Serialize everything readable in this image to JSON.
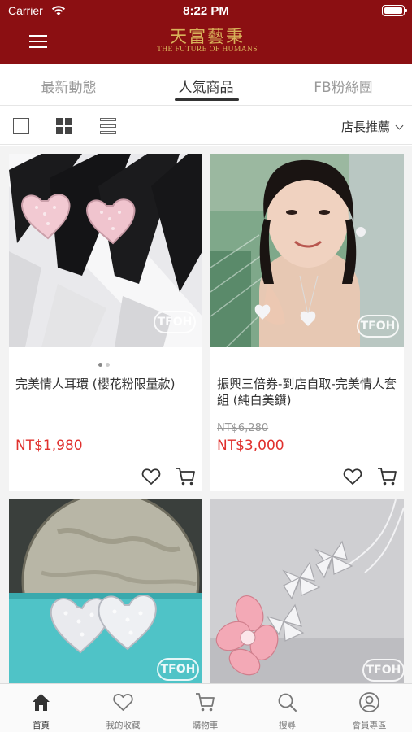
{
  "status_bar": {
    "carrier": "Carrier",
    "time": "8:22 PM"
  },
  "header": {
    "logo_main": "天富藝秉",
    "logo_sub": "THE FUTURE OF HUMANS",
    "color": "#8b0f12"
  },
  "tabs": [
    {
      "label": "最新動態",
      "active": false
    },
    {
      "label": "人氣商品",
      "active": true
    },
    {
      "label": "FB粉絲團",
      "active": false
    }
  ],
  "toolbar": {
    "sort_label": "店長推薦"
  },
  "watermark": "TFOH",
  "products": [
    {
      "name": "完美情人耳環 (櫻花粉限量款)",
      "original_price": "",
      "price": "NT$1,980"
    },
    {
      "name": "振興三倍券-到店自取-完美情人套組 (純白美鑽)",
      "original_price": "NT$6,280",
      "price": "NT$3,000"
    },
    {
      "name": "",
      "original_price": "",
      "price": ""
    },
    {
      "name": "",
      "original_price": "",
      "price": ""
    }
  ],
  "tabbar": [
    {
      "label": "首頁",
      "icon": "home-icon",
      "active": true
    },
    {
      "label": "我的收藏",
      "icon": "heart-icon",
      "active": false
    },
    {
      "label": "購物車",
      "icon": "cart-icon",
      "active": false
    },
    {
      "label": "搜尋",
      "icon": "search-icon",
      "active": false
    },
    {
      "label": "會員專區",
      "icon": "user-icon",
      "active": false
    }
  ],
  "colors": {
    "brand": "#8b0f12",
    "price": "#e0302d",
    "gold": "#d8b25a"
  }
}
